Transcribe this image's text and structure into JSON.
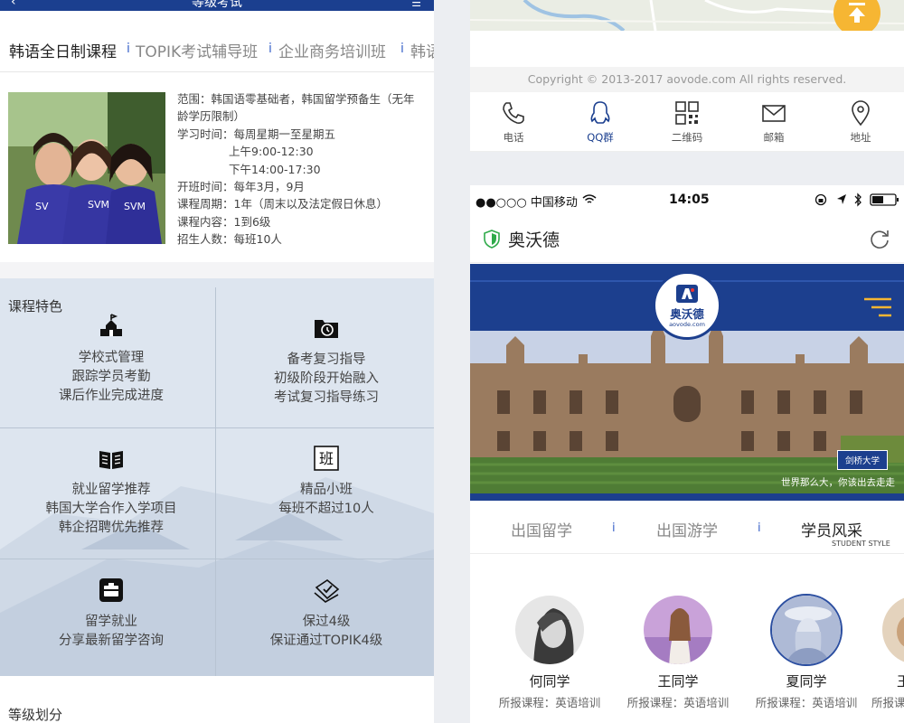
{
  "left": {
    "header_title": "等级考试",
    "tabs": [
      {
        "label": "韩语全日制课程"
      },
      {
        "label": "TOPIK考试辅导班"
      },
      {
        "label": "企业商务培训班"
      },
      {
        "label": "韩语"
      }
    ],
    "tab_separator": "i",
    "course_info": [
      "范围：韩国语零基础者，韩国留学预备生（无年",
      "龄学历限制）",
      "学习时间：每周星期一至星期五",
      "上午9:00-12:30",
      "下午14:00-17:30",
      "开班时间：每年3月，9月",
      "课程周期：1年（周末以及法定假日休息）",
      "课程内容：1到6级",
      "招生人数：每班10人"
    ],
    "features_title": "课程特色",
    "features": [
      {
        "icon": "school-icon",
        "lines": [
          "学校式管理",
          "跟踪学员考勤",
          "课后作业完成进度"
        ]
      },
      {
        "icon": "folder-history-icon",
        "lines": [
          "备考复习指导",
          "初级阶段开始融入",
          "考试复习指导练习"
        ]
      },
      {
        "icon": "book-icon",
        "lines": [
          "就业留学推荐",
          "韩国大学合作入学项目",
          "韩企招聘优先推荐"
        ]
      },
      {
        "icon": "class-icon",
        "glyph": "班",
        "lines": [
          "精品小班",
          "每班不超过10人"
        ]
      },
      {
        "icon": "briefcase-icon",
        "lines": [
          "留学就业",
          "分享最新留学咨询"
        ]
      },
      {
        "icon": "certificate-icon",
        "lines": [
          "保过4级",
          "保证通过TOPIK4级"
        ]
      }
    ],
    "section_title_bottom": "等级划分"
  },
  "right": {
    "copyright": "Copyright © 2013-2017  aovode.com  All rights reserved.",
    "nav": [
      {
        "label": "电话",
        "icon": "phone-icon"
      },
      {
        "label": "QQ群",
        "icon": "qq-icon"
      },
      {
        "label": "二维码",
        "icon": "qrcode-icon"
      },
      {
        "label": "邮箱",
        "icon": "mail-icon"
      },
      {
        "label": "地址",
        "icon": "location-icon"
      }
    ],
    "phone": {
      "carrier": "●●○○○ 中国移动",
      "time": "14:05",
      "site_name": "奥沃德",
      "logo_text": "奥沃德",
      "logo_sub": "aovode.com",
      "banner_badge": "剑桥大学",
      "banner_caption": "世界那么大，你该出去走走",
      "tabs": [
        {
          "label": "出国留学"
        },
        {
          "label": "出国游学"
        },
        {
          "label": "学员风采"
        }
      ],
      "tab_sub": "STUDENT STYLE",
      "students": [
        {
          "name": "何同学",
          "course": "所报课程：英语培训"
        },
        {
          "name": "王同学",
          "course": "所报课程：英语培训"
        },
        {
          "name": "夏同学",
          "course": "所报课程：英语培训"
        },
        {
          "name": "王",
          "course": "所报课程"
        }
      ]
    },
    "colors": {
      "brand_blue": "#1b3f8f",
      "accent_orange": "#f6b633",
      "panel_blue": "#dde5ef"
    }
  }
}
